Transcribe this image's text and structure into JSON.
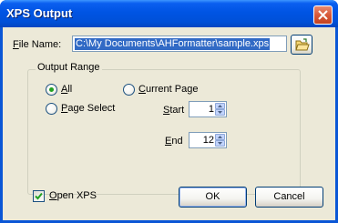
{
  "window": {
    "title": "XPS Output"
  },
  "file": {
    "label": "File Name:",
    "value": "C:\\My Documents\\AHFormatter\\sample.xps"
  },
  "range": {
    "group_title": "Output Range",
    "all_label": "All",
    "current_page_label": "Current Page",
    "page_select_label": "Page Select",
    "start_label": "Start",
    "start_value": "1",
    "end_label": "End",
    "end_value": "12",
    "selected": "All"
  },
  "open_xps": {
    "label": "Open XPS",
    "checked": true
  },
  "buttons": {
    "ok": "OK",
    "cancel": "Cancel"
  },
  "colors": {
    "title_bar": "#0054e3",
    "client_bg": "#ece9d8",
    "selection": "#316ac5",
    "close_button": "#d8593b"
  }
}
